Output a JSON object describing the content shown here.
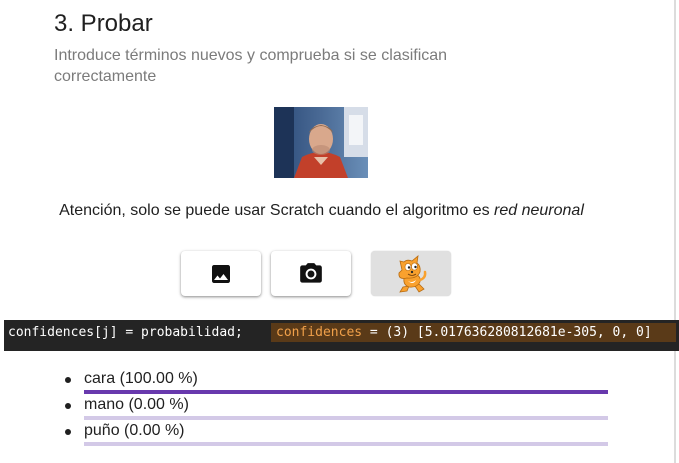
{
  "section": {
    "title": "3. Probar",
    "subtitle": "Introduce términos nuevos y comprueba si se clasifican correctamente"
  },
  "warning": {
    "text": "Atención, solo se puede usar Scratch cuando el algoritmo es ",
    "emphasis": "red neuronal"
  },
  "buttons": [
    {
      "icon": "image-icon"
    },
    {
      "icon": "camera-icon"
    },
    {
      "icon": "scratch-cat-icon"
    }
  ],
  "console": {
    "code": "confidences[j] = probabilidad;",
    "value_key": "confidences",
    "value_rest": " = (3) [5.017636280812681e-305, 0, 0]"
  },
  "results": [
    {
      "label": "cara (100.00 %)",
      "confidence": 1.0
    },
    {
      "label": "mano (0.00 %)",
      "confidence": 0.0
    },
    {
      "label": "puño (0.00 %)",
      "confidence": 0.0
    }
  ],
  "colors": {
    "bar_fill": "#6839ad",
    "bar_track": "#d3c9e7",
    "console_bg": "#242424",
    "console_highlight": "#5a3a18"
  }
}
